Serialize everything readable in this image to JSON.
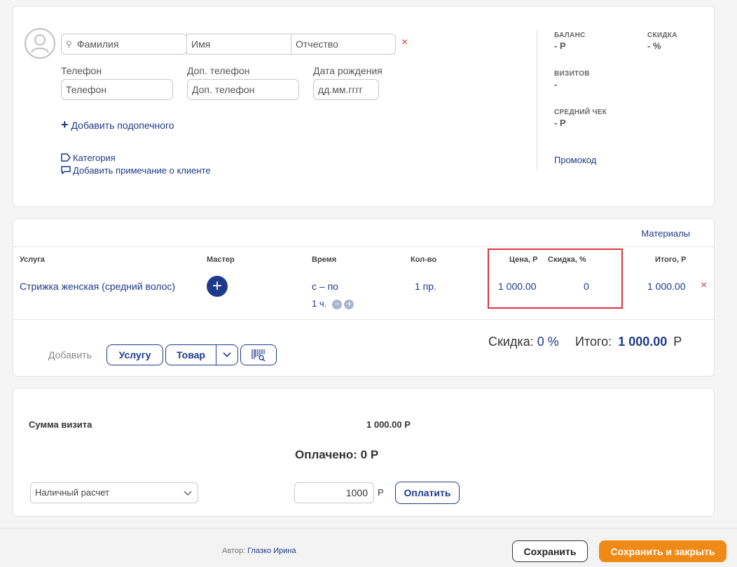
{
  "client": {
    "surname_placeholder": "Фамилия",
    "name_placeholder": "Имя",
    "patronymic_placeholder": "Отчество",
    "phone_label": "Телефон",
    "phone_placeholder": "Телефон",
    "extra_phone_label": "Доп. телефон",
    "extra_phone_placeholder": "Доп. телефон",
    "birthdate_label": "Дата рождения",
    "birthdate_placeholder": "дд.мм.гггг",
    "add_ward": "Добавить подопечного",
    "category": "Категория",
    "add_note": "Добавить примечание о клиенте"
  },
  "stats": {
    "balance_label": "БАЛАНС",
    "balance_value": "- Р",
    "discount_label": "СКИДКА",
    "discount_value": "- %",
    "visits_label": "ВИЗИТОВ",
    "visits_value": "-",
    "avg_check_label": "СРЕДНИЙ ЧЕК",
    "avg_check_value": "- Р",
    "promo": "Промокод"
  },
  "services": {
    "materials": "Материалы",
    "headers": {
      "service": "Услуга",
      "master": "Мастер",
      "time": "Время",
      "qty": "Кол-во",
      "price": "Цена, Р",
      "discount": "Скидка, %",
      "total": "Итого, Р"
    },
    "row": {
      "service": "Стрижка женская (средний волос)",
      "time_range": "с – по",
      "duration": "1 ч.",
      "qty": "1 пр.",
      "price": "1 000.00",
      "discount": "0",
      "total": "1 000.00"
    },
    "add_label": "Добавить",
    "add_service": "Услугу",
    "add_product": "Товар",
    "summary_discount_label": "Скидка:",
    "summary_discount_value": "0 %",
    "summary_total_label": "Итого:",
    "summary_total_value": "1 000.00",
    "summary_currency": "Р"
  },
  "payment": {
    "visit_sum_label": "Сумма визита",
    "visit_sum_value": "1 000.00 Р",
    "paid": "Оплачено: 0 Р",
    "method": "Наличный расчет",
    "amount": "1000",
    "currency": "Р",
    "pay_button": "Оплатить"
  },
  "footer": {
    "author_label": "Автор:",
    "author_name": "Глазко Ирина",
    "save": "Сохранить",
    "save_close": "Сохранить и закрыть"
  },
  "colors": {
    "accent": "#1e3a8a",
    "orange": "#ef8a17",
    "highlight": "#d9363e"
  }
}
